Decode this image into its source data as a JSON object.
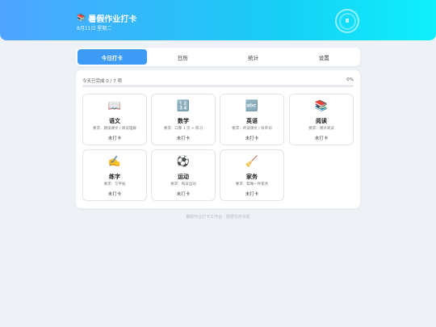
{
  "header": {
    "icon": "books-emoji",
    "emoji": "📚",
    "title": "暑假作业打卡",
    "date": "8月11日 星期二",
    "ring_label": "8"
  },
  "tabs": [
    {
      "label": "今日打卡",
      "active": true
    },
    {
      "label": "日历",
      "active": false
    },
    {
      "label": "统计",
      "active": false
    },
    {
      "label": "设置",
      "active": false
    }
  ],
  "progress": {
    "label": "今天已完成 0 / 7 项",
    "percent_label": "0%",
    "fraction": 0
  },
  "tasks": [
    {
      "emoji": "📖",
      "icon": "open-book-icon",
      "name": "语文",
      "requirement": "要求：朗读课文 / 阅读理解",
      "status": "未打卡"
    },
    {
      "emoji": "🔢",
      "icon": "numbers-icon",
      "name": "数学",
      "requirement": "要求：口算 1 页 + 练习",
      "status": "未打卡"
    },
    {
      "emoji": "🔤",
      "icon": "abc-icon",
      "name": "英语",
      "requirement": "要求：听读课文 / 背单词",
      "status": "未打卡"
    },
    {
      "emoji": "📚",
      "icon": "books-icon",
      "name": "阅读",
      "requirement": "要求：课外阅读",
      "status": "未打卡"
    },
    {
      "emoji": "✍️",
      "icon": "writing-hand-icon",
      "name": "练字",
      "requirement": "要求：写字帖",
      "status": "未打卡"
    },
    {
      "emoji": "⚽",
      "icon": "soccer-ball-icon",
      "name": "运动",
      "requirement": "要求：每日运动",
      "status": "未打卡"
    },
    {
      "emoji": "🧹",
      "icon": "broom-icon",
      "name": "家务",
      "requirement": "要求：帮做一件家务",
      "status": "未打卡"
    }
  ],
  "footer": "暑假作业打卡工作台 · 数据仅存本机",
  "colors": {
    "accent": "#3d9bf6",
    "header_start": "#4fa4ff",
    "header_end": "#0ff0fc",
    "background": "#eef2f7"
  }
}
